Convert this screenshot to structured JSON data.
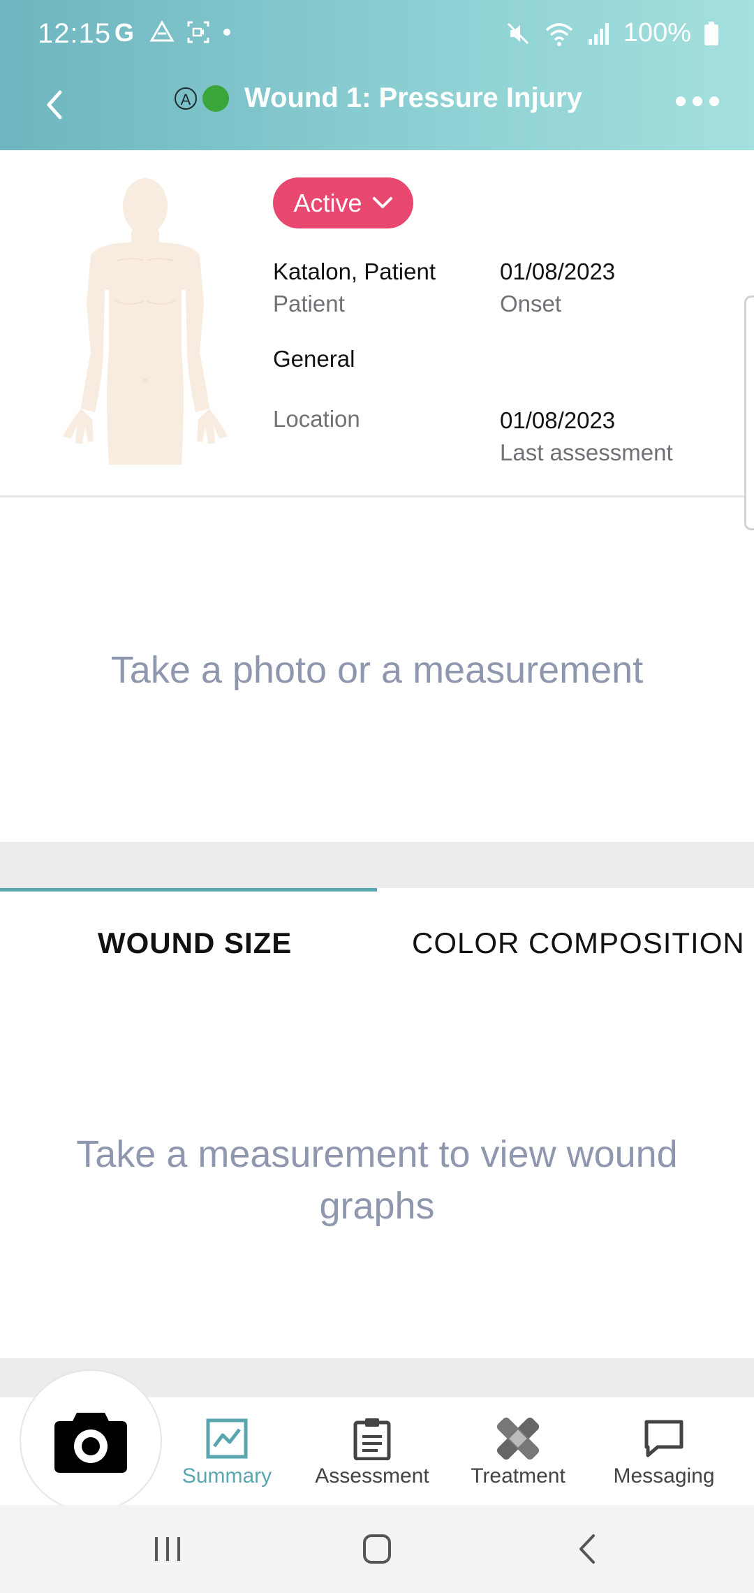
{
  "status_bar": {
    "time": "12:15",
    "battery": "100%"
  },
  "header": {
    "badge_letter": "A",
    "title": "Wound 1: Pressure Injury"
  },
  "info": {
    "status": "Active",
    "patient_value": "Katalon, Patient",
    "patient_label": "Patient",
    "onset_value": "01/08/2023",
    "onset_label": "Onset",
    "location_value": "General",
    "location_label": "Location",
    "last_assessment_value": "01/08/2023",
    "last_assessment_label": "Last assessment"
  },
  "photo_prompt": "Take a photo or a measurement",
  "tabs": [
    {
      "label": "WOUND SIZE",
      "active": true
    },
    {
      "label": "COLOR COMPOSITION",
      "active": false
    }
  ],
  "graph_prompt": "Take a measurement to view wound graphs",
  "bottom_nav": [
    {
      "label": "Summary",
      "icon": "chart-icon",
      "active": true
    },
    {
      "label": "Assessment",
      "icon": "clipboard-icon",
      "active": false
    },
    {
      "label": "Treatment",
      "icon": "bandage-icon",
      "active": false
    },
    {
      "label": "Messaging",
      "icon": "chat-icon",
      "active": false
    }
  ],
  "colors": {
    "accent": "#5aa6b0",
    "status_pill": "#e8486f",
    "status_dot": "#3aa53a",
    "prompt_text": "#8e97ad"
  }
}
